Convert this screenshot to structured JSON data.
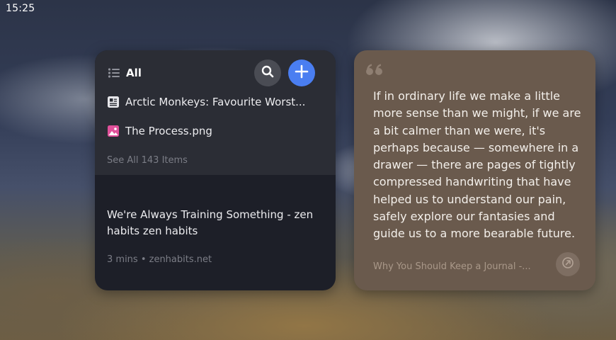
{
  "status_bar": {
    "time": "15:25"
  },
  "left_widget": {
    "header": {
      "filter_label": "All",
      "filter_icon": "list-icon",
      "search_icon": "search-icon",
      "add_icon": "plus-icon"
    },
    "items": [
      {
        "icon": "article-icon",
        "title": "Arctic Monkeys: Favourite Worst..."
      },
      {
        "icon": "image-icon",
        "title": "The Process.png"
      }
    ],
    "see_all": "See All 143 Items",
    "featured": {
      "title": "We're Always Training Something - zen habits zen habits",
      "meta": "3 mins • zenhabits.net"
    },
    "colors": {
      "accent": "#4a7ef1",
      "image_icon": "#e0509a"
    }
  },
  "right_widget": {
    "quote_icon": "quote-icon",
    "quote": "If in ordinary life we make a little more sense than we might, if we are a bit calmer than we were, it's perhaps because — somewhere in a drawer — there are pages of tightly compressed handwriting that have helped us to understand our pain, safely explore our fantasies and guide us to a more bearable future.",
    "source": "Why You Should Keep a Journal -...",
    "open_icon": "external-link-icon"
  }
}
